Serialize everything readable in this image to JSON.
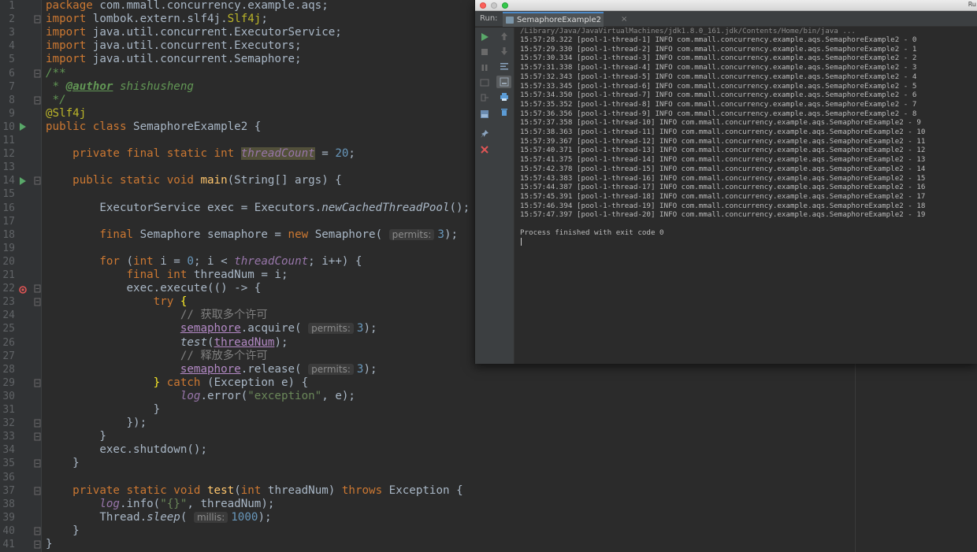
{
  "editor": {
    "lines": [
      {
        "n": "1",
        "html": "<span class=\"kw\">package</span> com.mmall.concurrency.example.aqs;"
      },
      {
        "n": "2",
        "html": "<span class=\"kw\">import</span> lombok.extern.slf4j.<span class=\"ann\">Slf4j</span>;"
      },
      {
        "n": "3",
        "html": "<span class=\"kw\">import</span> java.util.concurrent.ExecutorService;"
      },
      {
        "n": "4",
        "html": "<span class=\"kw\">import</span> java.util.concurrent.Executors;"
      },
      {
        "n": "5",
        "html": "<span class=\"kw\">import</span> java.util.concurrent.Semaphore;"
      },
      {
        "n": "6",
        "html": "<span class=\"doc\">/**</span>"
      },
      {
        "n": "7",
        "html": "<span class=\"doc\"> * </span><span class=\"doctag\">@author</span><span class=\"doc\"> shishusheng</span>"
      },
      {
        "n": "8",
        "html": "<span class=\"doc\"> */</span>"
      },
      {
        "n": "9",
        "html": "<span class=\"ann\">@Slf4j</span>"
      },
      {
        "n": "10",
        "html": "<span class=\"kw\">public class</span> SemaphoreExample2 {"
      },
      {
        "n": "11",
        "html": ""
      },
      {
        "n": "12",
        "html": "    <span class=\"kw\">private final static int</span> <span class=\"static-hl\">threadCount</span> = <span class=\"num\">20</span>;"
      },
      {
        "n": "13",
        "html": ""
      },
      {
        "n": "14",
        "html": "    <span class=\"kw\">public static void</span> <span class=\"fn\">main</span>(String[] args) {"
      },
      {
        "n": "15",
        "html": ""
      },
      {
        "n": "16",
        "html": "        ExecutorService exec = Executors.<span class=\"sm\">newCachedThreadPool</span>();"
      },
      {
        "n": "17",
        "html": ""
      },
      {
        "n": "18",
        "html": "        <span class=\"kw\">final</span> Semaphore semaphore = <span class=\"kw\">new</span> Semaphore( <span class=\"hint\">permits:</span><span class=\"num\">3</span>);"
      },
      {
        "n": "19",
        "html": ""
      },
      {
        "n": "20",
        "html": "        <span class=\"kw\">for</span> (<span class=\"kw\">int</span> i = <span class=\"num\">0</span>; i &lt; <span class=\"static\">threadCount</span>; i++) {"
      },
      {
        "n": "21",
        "html": "            <span class=\"kw\">final int</span> threadNum = i;"
      },
      {
        "n": "22",
        "html": "            exec.execute(() -&gt; {"
      },
      {
        "n": "23",
        "html": "                <span class=\"kw\">try</span> <span class=\"brace-hl\">{</span>"
      },
      {
        "n": "24",
        "html": "                    <span class=\"cmt\">// 获取多个许可</span>"
      },
      {
        "n": "25",
        "html": "                    <span class=\"lambda-var\">semaphore</span>.acquire( <span class=\"hint\">permits:</span><span class=\"num\">3</span>);"
      },
      {
        "n": "26",
        "html": "                    <span class=\"sm\">test</span>(<span class=\"lambda-var\">threadNum</span>);"
      },
      {
        "n": "27",
        "html": "                    <span class=\"cmt\">// 释放多个许可</span>"
      },
      {
        "n": "28",
        "html": "                    <span class=\"lambda-var\">semaphore</span>.release( <span class=\"hint\">permits:</span><span class=\"num\">3</span>);"
      },
      {
        "n": "29",
        "html": "                <span class=\"brace-hl\">}</span> <span class=\"kw\">catch</span> (Exception e) {"
      },
      {
        "n": "30",
        "html": "                    <span class=\"static\">log</span>.error(<span class=\"str\">\"exception\"</span>, e);"
      },
      {
        "n": "31",
        "html": "                }"
      },
      {
        "n": "32",
        "html": "            });"
      },
      {
        "n": "33",
        "html": "        }"
      },
      {
        "n": "34",
        "html": "        exec.shutdown();"
      },
      {
        "n": "35",
        "html": "    }"
      },
      {
        "n": "36",
        "html": ""
      },
      {
        "n": "37",
        "html": "    <span class=\"kw\">private static void</span> <span class=\"fn\">test</span>(<span class=\"kw\">int</span> threadNum) <span class=\"kw\">throws</span> Exception {"
      },
      {
        "n": "38",
        "html": "        <span class=\"static\">log</span>.info(<span class=\"str\">\"{}\"</span>, threadNum);"
      },
      {
        "n": "39",
        "html": "        Thread.<span class=\"sm\">sleep</span>( <span class=\"hint\">millis:</span><span class=\"num\">1000</span>);"
      },
      {
        "n": "40",
        "html": "    }"
      },
      {
        "n": "41",
        "html": "}"
      }
    ]
  },
  "run": {
    "title_right": "Ru",
    "label": "Run:",
    "tab_label": "SemaphoreExample2",
    "tab_close": "×",
    "command": "/Library/Java/JavaVirtualMachines/jdk1.8.0_161.jdk/Contents/Home/bin/java ...",
    "output": [
      "15:57:28.322 [pool-1-thread-1] INFO com.mmall.concurrency.example.aqs.SemaphoreExample2 - 0",
      "15:57:29.330 [pool-1-thread-2] INFO com.mmall.concurrency.example.aqs.SemaphoreExample2 - 1",
      "15:57:30.334 [pool-1-thread-3] INFO com.mmall.concurrency.example.aqs.SemaphoreExample2 - 2",
      "15:57:31.338 [pool-1-thread-4] INFO com.mmall.concurrency.example.aqs.SemaphoreExample2 - 3",
      "15:57:32.343 [pool-1-thread-5] INFO com.mmall.concurrency.example.aqs.SemaphoreExample2 - 4",
      "15:57:33.345 [pool-1-thread-6] INFO com.mmall.concurrency.example.aqs.SemaphoreExample2 - 5",
      "15:57:34.350 [pool-1-thread-7] INFO com.mmall.concurrency.example.aqs.SemaphoreExample2 - 6",
      "15:57:35.352 [pool-1-thread-8] INFO com.mmall.concurrency.example.aqs.SemaphoreExample2 - 7",
      "15:57:36.356 [pool-1-thread-9] INFO com.mmall.concurrency.example.aqs.SemaphoreExample2 - 8",
      "15:57:37.358 [pool-1-thread-10] INFO com.mmall.concurrency.example.aqs.SemaphoreExample2 - 9",
      "15:57:38.363 [pool-1-thread-11] INFO com.mmall.concurrency.example.aqs.SemaphoreExample2 - 10",
      "15:57:39.367 [pool-1-thread-12] INFO com.mmall.concurrency.example.aqs.SemaphoreExample2 - 11",
      "15:57:40.371 [pool-1-thread-13] INFO com.mmall.concurrency.example.aqs.SemaphoreExample2 - 12",
      "15:57:41.375 [pool-1-thread-14] INFO com.mmall.concurrency.example.aqs.SemaphoreExample2 - 13",
      "15:57:42.378 [pool-1-thread-15] INFO com.mmall.concurrency.example.aqs.SemaphoreExample2 - 14",
      "15:57:43.383 [pool-1-thread-16] INFO com.mmall.concurrency.example.aqs.SemaphoreExample2 - 15",
      "15:57:44.387 [pool-1-thread-17] INFO com.mmall.concurrency.example.aqs.SemaphoreExample2 - 16",
      "15:57:45.391 [pool-1-thread-18] INFO com.mmall.concurrency.example.aqs.SemaphoreExample2 - 17",
      "15:57:46.394 [pool-1-thread-19] INFO com.mmall.concurrency.example.aqs.SemaphoreExample2 - 18",
      "15:57:47.397 [pool-1-thread-20] INFO com.mmall.concurrency.example.aqs.SemaphoreExample2 - 19"
    ],
    "exit_message": "Process finished with exit code 0"
  },
  "icons": {
    "run": "run-icon",
    "stop": "stop-icon",
    "rerun": "rerun-icon",
    "pause": "pause-icon",
    "scroll-up": "scroll-up-icon",
    "scroll-down": "scroll-down-icon",
    "breakpoint": "breakpoint-icon",
    "close": "close-icon",
    "pin": "pin-icon",
    "print": "print-icon",
    "trash": "trash-icon"
  },
  "colors": {
    "editor_bg": "#2b2b2b",
    "keyword": "#cc7832",
    "annotation": "#bbb529",
    "string": "#6a8759",
    "number": "#6897bb",
    "static_field": "#9876aa",
    "console_text": "#bbbbbb",
    "run_green": "#59a869",
    "close_red": "#e05555"
  }
}
